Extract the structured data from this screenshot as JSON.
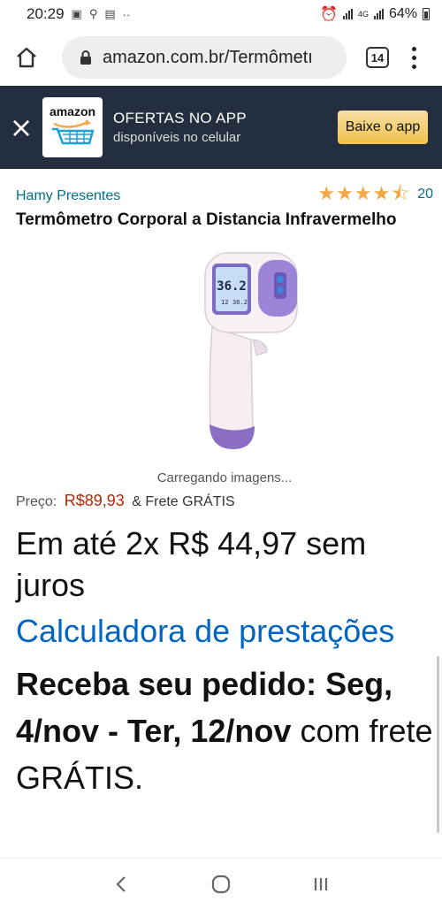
{
  "status_bar": {
    "time": "20:29",
    "battery": "64%",
    "network": "4G"
  },
  "browser": {
    "url": "amazon.com.br/Termômetı",
    "tab_count": "14"
  },
  "app_banner": {
    "logo_text": "amazon",
    "title": "OFERTAS NO APP",
    "subtitle": "disponíveis no celular",
    "download_label": "Baixe o app"
  },
  "product": {
    "brand": "Hamy Presentes",
    "rating": 4.5,
    "review_count": "20",
    "title": "Termômetro Corporal a Distancia Infravermelho",
    "image_loading": "Carregando imagens...",
    "device_display_main": "36.2",
    "device_display_sub_left": "12",
    "device_display_sub_right": "36.2"
  },
  "price": {
    "label": "Preço:",
    "value": "R$89,93",
    "shipping": "& Frete GRÁTIS"
  },
  "installments": "Em até 2x R$ 44,97 sem juros",
  "calculator_link": "Calculadora de prestações",
  "delivery": {
    "prefix": "Receba seu pedido: Seg, 4/nov - Ter, 12/nov",
    "suffix": "com frete GRÁTIS."
  },
  "colors": {
    "brand_link": "#007185",
    "price": "#b12704",
    "link": "#0066c0",
    "banner_bg": "#232f3e",
    "button": "#f0c14b",
    "star": "#f3a847"
  }
}
